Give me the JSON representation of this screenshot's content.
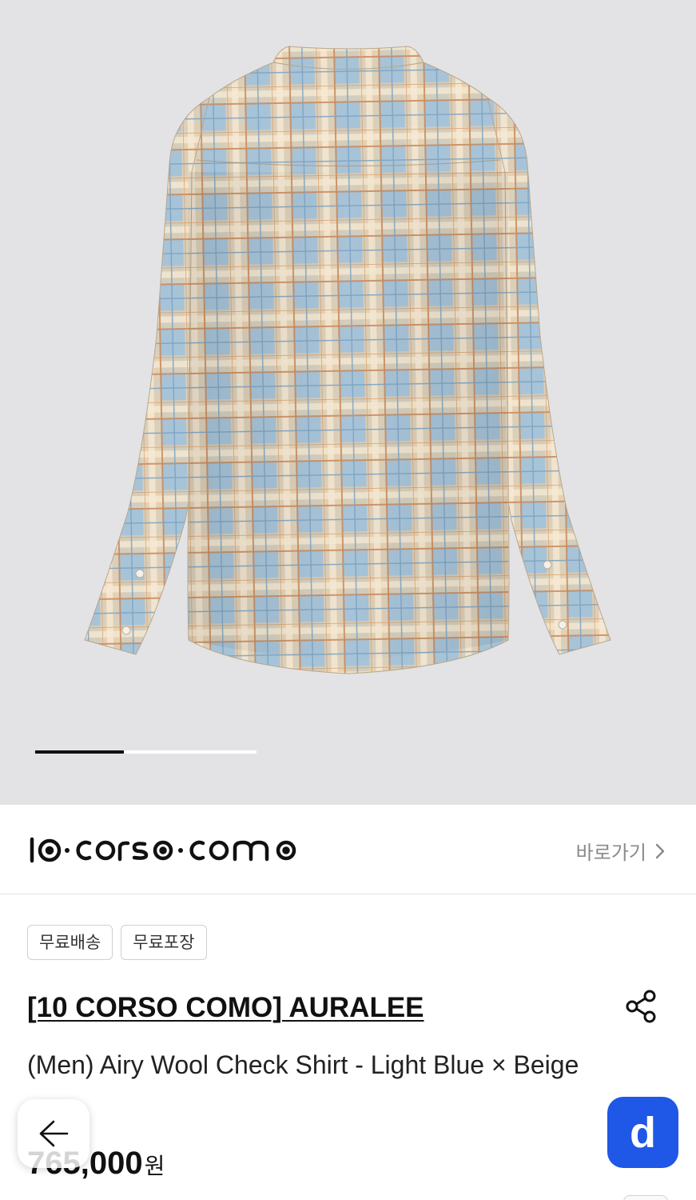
{
  "hero": {
    "image_alt": "Airy Wool Check Shirt back view",
    "gallery_progress": 0.4
  },
  "store": {
    "logo_text": "10·corso·como",
    "goto_label": "바로가기"
  },
  "badges": [
    "무료배송",
    "무료포장"
  ],
  "product": {
    "brand_title": "[10 CORSO COMO] AURALEE",
    "name": "(Men) Airy Wool Check Shirt - Light Blue × Beige",
    "price": "765,000",
    "currency": "원"
  },
  "floating": {
    "d_button_label": "d"
  },
  "colors": {
    "accent_blue": "#1f57e6",
    "hero_bg": "#e3e3e5",
    "shirt_blue": "#9fbfd6",
    "shirt_beige": "#e9cfa8",
    "shirt_rust": "#c98a5c"
  },
  "icons": {
    "back": "arrow-left-icon",
    "share": "share-icon",
    "goto": "chevron-right-icon"
  }
}
